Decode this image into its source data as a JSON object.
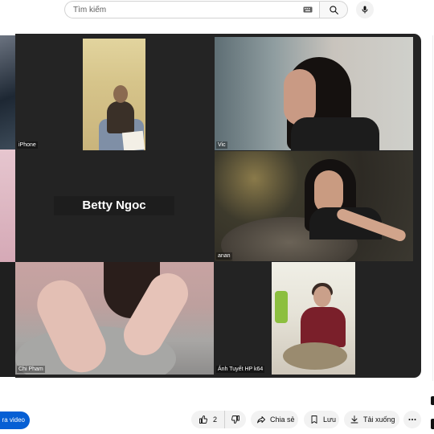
{
  "search": {
    "placeholder": "Tìm kiếm"
  },
  "participants": [
    {
      "name": "iPhone"
    },
    {
      "name": "Vic"
    },
    {
      "name": "Betty Ngoc"
    },
    {
      "name": "anan"
    },
    {
      "name": "Chi Pham"
    },
    {
      "name": "Ánh Tuyết HP k64"
    }
  ],
  "actions": {
    "subscribe_partial": "ra video",
    "like_count": "2",
    "share_label": "Chia sẻ",
    "save_label": "Lưu",
    "download_label": "Tải xuống"
  },
  "colors": {
    "accent": "#065fd4",
    "player_bg": "#232323",
    "pill_bg": "#f2f2f2"
  },
  "icons": [
    "keyboard-icon",
    "search-icon",
    "mic-icon",
    "thumbs-up-icon",
    "thumbs-down-icon",
    "share-icon",
    "bookmark-icon",
    "download-icon",
    "more-icon"
  ]
}
